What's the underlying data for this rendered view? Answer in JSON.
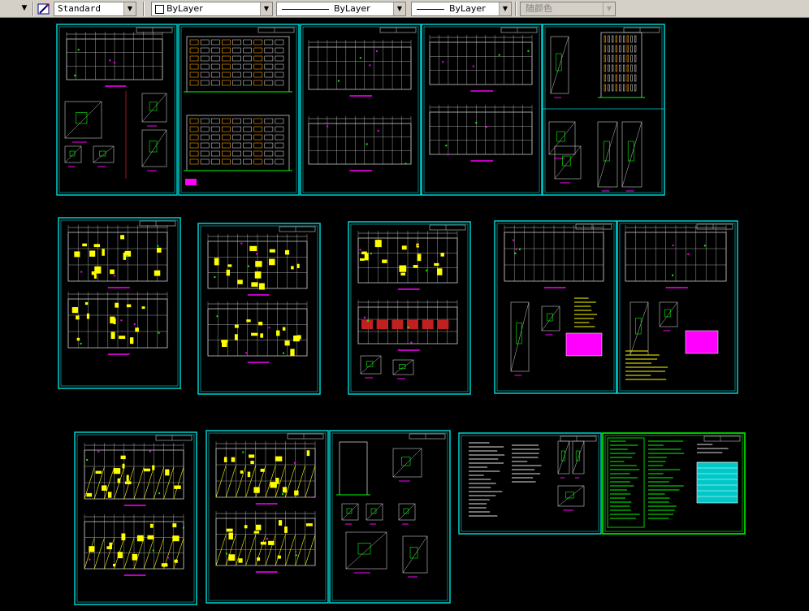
{
  "toolbar": {
    "textstyle_value": "Standard",
    "layer_value": "ByLayer",
    "linetype_value": "ByLayer",
    "lineweight_value": "ByLayer",
    "color_value": "随颜色"
  },
  "colors": {
    "background": "#000000",
    "sheet_border": "#00d0d0",
    "drawing_lines": "#c8c8c8",
    "highlight_yellow": "#ffff00",
    "highlight_magenta": "#ff00ff",
    "legend_green": "#00ff00"
  },
  "icons": {
    "text_style": "text-style-icon",
    "layer": "layer-icon"
  }
}
